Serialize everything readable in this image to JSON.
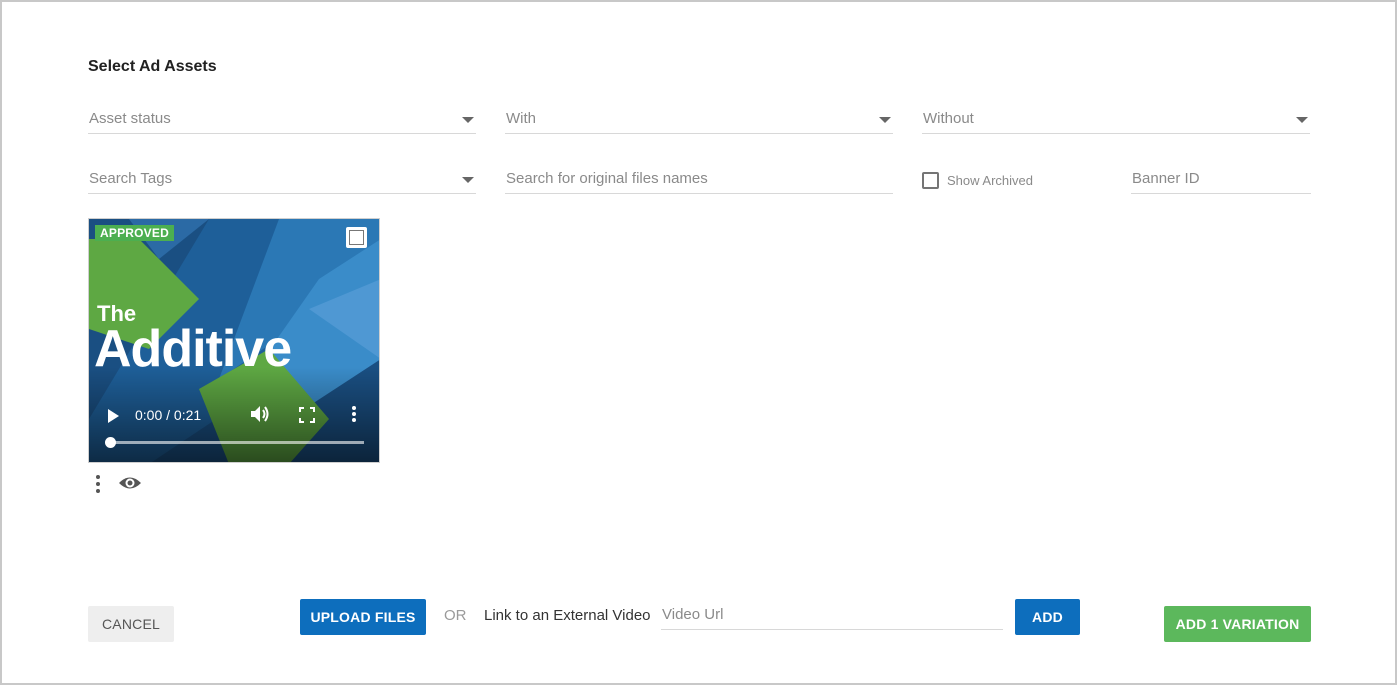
{
  "dialog": {
    "title": "Select Ad Assets"
  },
  "filters": {
    "asset_status": {
      "placeholder": "Asset status"
    },
    "with": {
      "placeholder": "With"
    },
    "without": {
      "placeholder": "Without"
    },
    "search_tags": {
      "placeholder": "Search Tags"
    },
    "search_files": {
      "placeholder": "Search for original files names"
    },
    "show_archived": {
      "label": "Show Archived",
      "checked": false
    },
    "banner_id": {
      "placeholder": "Banner ID"
    }
  },
  "assets": [
    {
      "status_badge": "APPROVED",
      "selected": false,
      "thumbnail_text_small": "The",
      "thumbnail_text_large": "Additive",
      "player": {
        "time": "0:00 / 0:21",
        "progress": 0
      },
      "actions": [
        "more-vert-icon",
        "eye-icon"
      ]
    }
  ],
  "footer": {
    "cancel_label": "CANCEL",
    "upload_label": "UPLOAD FILES",
    "or_label": "OR",
    "external_label": "Link to an External Video",
    "video_url_placeholder": "Video Url",
    "add_label": "ADD",
    "add_variation_label": "ADD 1 VARIATION"
  },
  "colors": {
    "primary": "#0d6ebd",
    "success": "#5cb85c",
    "badge": "#4caf50"
  }
}
